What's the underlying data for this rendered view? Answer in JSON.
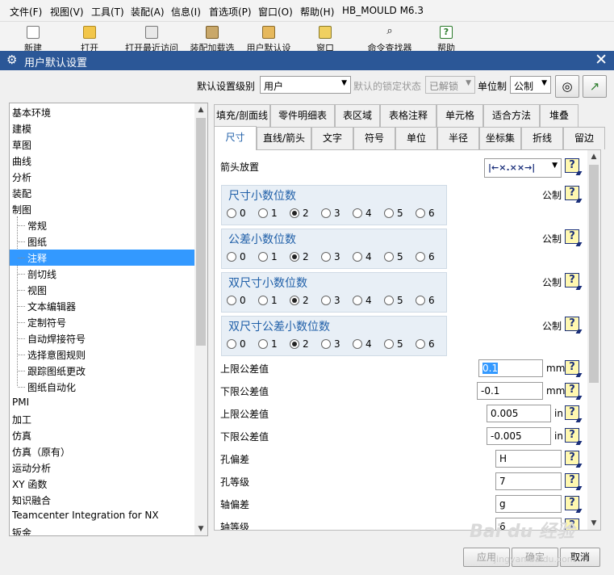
{
  "menubar": {
    "items": [
      "文件(F)",
      "视图(V)",
      "工具(T)",
      "装配(A)",
      "信息(I)",
      "首选项(P)",
      "窗口(O)",
      "帮助(H)",
      "HB_MOULD M6.3"
    ]
  },
  "toolbar": {
    "buttons": [
      {
        "label": "新建",
        "icon": "new-file-icon"
      },
      {
        "label": "打开",
        "icon": "open-folder-icon"
      },
      {
        "label": "打开最近访问",
        "icon": "recent-icon"
      },
      {
        "label": "装配加载选",
        "icon": "assembly-icon"
      },
      {
        "label": "用户默认设",
        "icon": "user-defaults-icon"
      },
      {
        "label": "窗口",
        "icon": "window-icon"
      },
      {
        "label": "命令查找器",
        "icon": "search-icon"
      },
      {
        "label": "帮助",
        "icon": "help-icon"
      }
    ]
  },
  "dialog": {
    "title": "用户默认设置",
    "level_label": "默认设置级别",
    "level_value": "用户",
    "lock_label": "默认的锁定状态",
    "lock_value": "已解锁",
    "units_label": "单位制",
    "units_value": "公制"
  },
  "tree": {
    "items": [
      {
        "label": "基本环境",
        "child": false
      },
      {
        "label": "建模",
        "child": false
      },
      {
        "label": "草图",
        "child": false
      },
      {
        "label": "曲线",
        "child": false
      },
      {
        "label": "分析",
        "child": false
      },
      {
        "label": "装配",
        "child": false
      },
      {
        "label": "制图",
        "child": false
      },
      {
        "label": "常规",
        "child": true
      },
      {
        "label": "图纸",
        "child": true
      },
      {
        "label": "注释",
        "child": true,
        "selected": true
      },
      {
        "label": "剖切线",
        "child": true
      },
      {
        "label": "视图",
        "child": true
      },
      {
        "label": "文本编辑器",
        "child": true
      },
      {
        "label": "定制符号",
        "child": true
      },
      {
        "label": "自动焊接符号",
        "child": true
      },
      {
        "label": "选择意图规则",
        "child": true
      },
      {
        "label": "跟踪图纸更改",
        "child": true
      },
      {
        "label": "图纸自动化",
        "child": true
      },
      {
        "label": "PMI",
        "child": false
      },
      {
        "label": "加工",
        "child": false
      },
      {
        "label": "仿真",
        "child": false
      },
      {
        "label": "仿真（原有）",
        "child": false
      },
      {
        "label": "运动分析",
        "child": false
      },
      {
        "label": "XY 函数",
        "child": false
      },
      {
        "label": "知识融合",
        "child": false
      },
      {
        "label": "Teamcenter Integration for NX",
        "child": false
      },
      {
        "label": "钣金",
        "child": false
      }
    ]
  },
  "tabs": {
    "row1": [
      "填充/剖面线",
      "零件明细表",
      "表区域",
      "表格注释",
      "单元格",
      "适合方法",
      "堆叠"
    ],
    "row2": [
      "尺寸",
      "直线/箭头",
      "文字",
      "符号",
      "单位",
      "半径",
      "坐标集",
      "折线",
      "留边"
    ],
    "active": "尺寸"
  },
  "panel": {
    "arrow_label": "箭头放置",
    "arrow_value": "|←×.××→|",
    "groups": [
      {
        "title": "尺寸小数位数",
        "selected": "2",
        "unit": "公制"
      },
      {
        "title": "公差小数位数",
        "selected": "2",
        "unit": "公制"
      },
      {
        "title": "双尺寸小数位数",
        "selected": "2",
        "unit": "公制"
      },
      {
        "title": "双尺寸公差小数位数",
        "selected": "2",
        "unit": "公制"
      }
    ],
    "radio_options": [
      "0",
      "1",
      "2",
      "3",
      "4",
      "5",
      "6"
    ],
    "fields": [
      {
        "label": "上限公差值",
        "value": "0.1",
        "unit": "mm"
      },
      {
        "label": "下限公差值",
        "value": "-0.1",
        "unit": "mm"
      },
      {
        "label": "上限公差值",
        "value": "0.005",
        "unit": "in"
      },
      {
        "label": "下限公差值",
        "value": "-0.005",
        "unit": "in"
      },
      {
        "label": "孔偏差",
        "value": "H",
        "unit": ""
      },
      {
        "label": "孔等级",
        "value": "7",
        "unit": ""
      },
      {
        "label": "轴偏差",
        "value": "g",
        "unit": ""
      },
      {
        "label": "轴等级",
        "value": "6",
        "unit": ""
      }
    ],
    "help_glyph": "?"
  },
  "buttons": {
    "apply": "应用",
    "ok": "确定",
    "cancel": "取消"
  },
  "watermark": {
    "text": "Bai du 经验",
    "url": "jingyan.baidu.com"
  }
}
